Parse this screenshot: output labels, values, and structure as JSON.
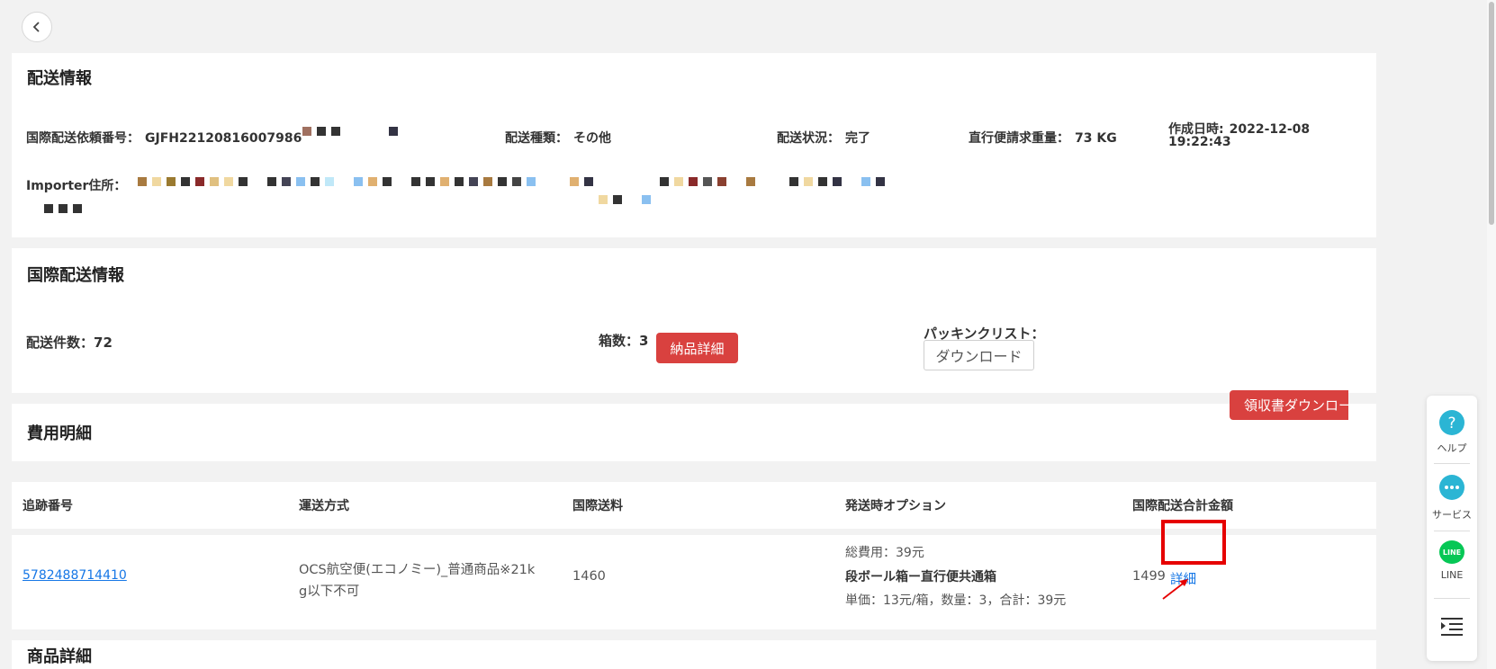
{
  "shipping_info": {
    "title": "配送情報",
    "request_no_label": "国際配送依頼番号：",
    "request_no_value": "GJFH22120816007986",
    "type_label": "配送種類：",
    "type_value": "その他",
    "status_label": "配送状況：",
    "status_value": "完了",
    "weight_label": "直行便請求重量：",
    "weight_value": "73 KG",
    "created_label": "作成日時:",
    "created_value": "2022-12-08",
    "created_time": "19:22:43",
    "importer_label": "Importer住所："
  },
  "intl_info": {
    "title": "国際配送情報",
    "count_label": "配送件数：",
    "count_value": "72",
    "boxes_label": "箱数：",
    "boxes_value": "3",
    "delivery_detail_button": "納品詳細",
    "packing_label": "パッキンクリスト：",
    "download_button": "ダウンロード"
  },
  "fees": {
    "title": "費用明細",
    "receipt_button": "領収書ダウンロード"
  },
  "table": {
    "headers": [
      "追跡番号",
      "運送方式",
      "国際送料",
      "発送時オプション",
      "国際配送合計金額"
    ],
    "row": {
      "tracking": "5782488714410",
      "method_line1": "OCS航空便(エコノミー)_普通商品※21k",
      "method_line2": "g以下不可",
      "intl_fee": "1460",
      "opt_total": "総費用：39元",
      "opt_name": "段ボール箱ー直行便共通箱",
      "opt_detail": "単価：13元/箱，数量：3，合計：39元",
      "total": "1499",
      "detail_link": "詳細"
    }
  },
  "products": {
    "title": "商品詳細"
  },
  "sidebar": {
    "help": "ヘルプ",
    "service": "サービス",
    "line": "LINE",
    "line_icon_text": "LINE"
  },
  "colors": {
    "accent_red": "#d9413f",
    "link_blue": "#1677e6",
    "highlight_red": "#e60000",
    "line_green": "#06c755",
    "help_teal": "#2bb5d4"
  }
}
